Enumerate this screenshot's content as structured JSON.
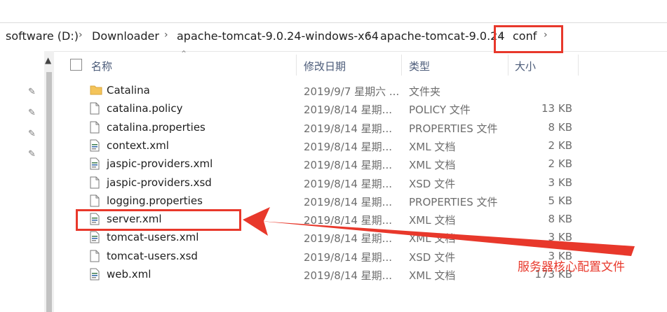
{
  "breadcrumb": [
    "software (D:)",
    "Downloader",
    "apache-tomcat-9.0.24-windows-x64",
    "apache-tomcat-9.0.24",
    "conf"
  ],
  "columns": {
    "name": "名称",
    "date": "修改日期",
    "type": "类型",
    "size": "大小"
  },
  "files": [
    {
      "name": "Catalina",
      "date": "2019/9/7 星期六 ...",
      "type": "文件夹",
      "size": "",
      "icon": "folder-icon"
    },
    {
      "name": "catalina.policy",
      "date": "2019/8/14 星期...",
      "type": "POLICY 文件",
      "size": "13 KB",
      "icon": "file-icon"
    },
    {
      "name": "catalina.properties",
      "date": "2019/8/14 星期...",
      "type": "PROPERTIES 文件",
      "size": "8 KB",
      "icon": "file-icon"
    },
    {
      "name": "context.xml",
      "date": "2019/8/14 星期...",
      "type": "XML 文档",
      "size": "2 KB",
      "icon": "xml-file-icon"
    },
    {
      "name": "jaspic-providers.xml",
      "date": "2019/8/14 星期...",
      "type": "XML 文档",
      "size": "2 KB",
      "icon": "xml-file-icon"
    },
    {
      "name": "jaspic-providers.xsd",
      "date": "2019/8/14 星期...",
      "type": "XSD 文件",
      "size": "3 KB",
      "icon": "file-icon"
    },
    {
      "name": "logging.properties",
      "date": "2019/8/14 星期...",
      "type": "PROPERTIES 文件",
      "size": "5 KB",
      "icon": "file-icon"
    },
    {
      "name": "server.xml",
      "date": "2019/8/14 星期...",
      "type": "XML 文档",
      "size": "8 KB",
      "icon": "xml-file-icon"
    },
    {
      "name": "tomcat-users.xml",
      "date": "2019/8/14 星期...",
      "type": "XML 文档",
      "size": "3 KB",
      "icon": "xml-file-icon"
    },
    {
      "name": "tomcat-users.xsd",
      "date": "2019/8/14 星期...",
      "type": "XSD 文件",
      "size": "3 KB",
      "icon": "file-icon"
    },
    {
      "name": "web.xml",
      "date": "2019/8/14 星期...",
      "type": "XML 文档",
      "size": "173 KB",
      "icon": "xml-file-icon"
    }
  ],
  "annotation": "服务器核心配置文件",
  "colors": {
    "highlight": "#e8382b",
    "folder": "#f4c45a"
  }
}
